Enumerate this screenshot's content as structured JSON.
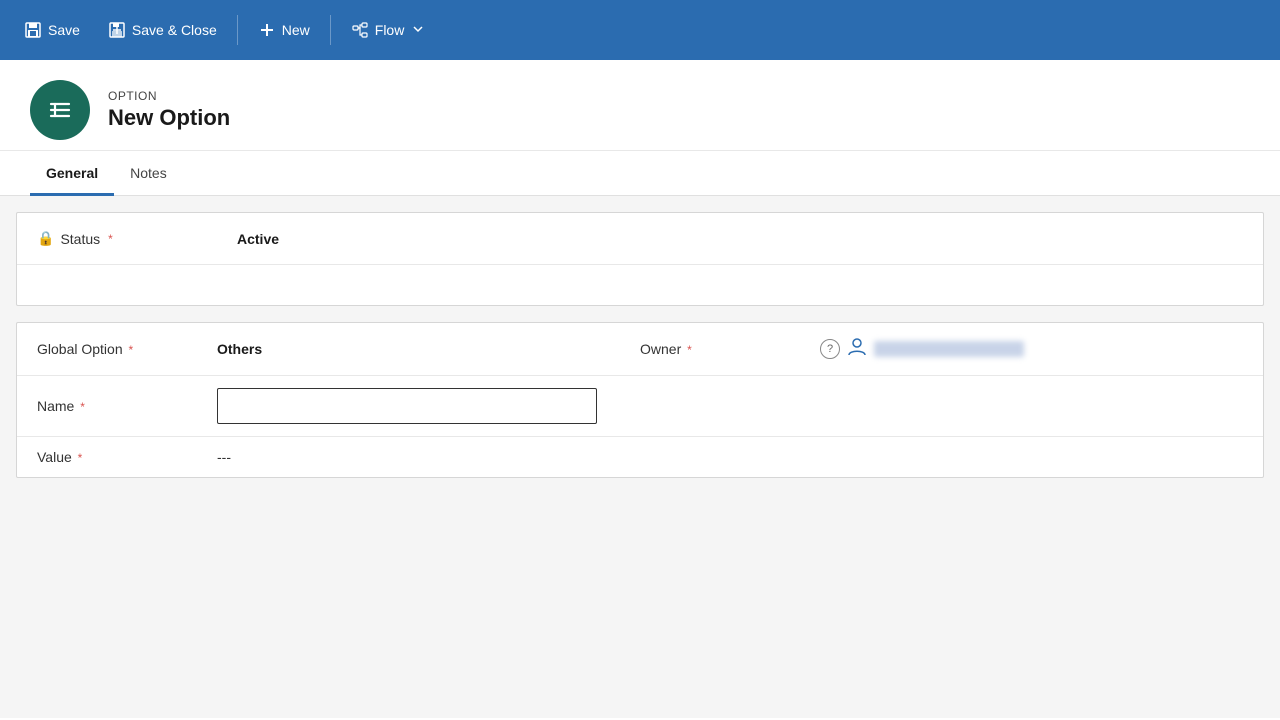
{
  "toolbar": {
    "save_label": "Save",
    "save_close_label": "Save & Close",
    "new_label": "New",
    "flow_label": "Flow"
  },
  "header": {
    "subtitle": "OPTION",
    "title": "New Option"
  },
  "tabs": [
    {
      "id": "general",
      "label": "General",
      "active": true
    },
    {
      "id": "notes",
      "label": "Notes",
      "active": false
    }
  ],
  "status_section": {
    "label": "Status",
    "required": "*",
    "value": "Active"
  },
  "details_section": {
    "global_option_label": "Global Option",
    "global_option_required": "*",
    "global_option_value": "Others",
    "owner_label": "Owner",
    "owner_required": "*",
    "name_label": "Name",
    "name_required": "*",
    "name_value": "",
    "name_placeholder": "",
    "value_label": "Value",
    "value_required": "*",
    "value_value": "---"
  }
}
